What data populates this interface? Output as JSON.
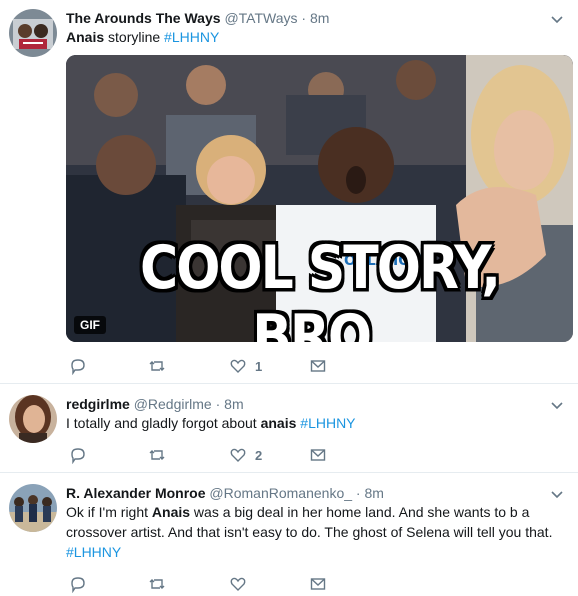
{
  "tweets": [
    {
      "name": "The Arounds The Ways",
      "handle": "@TATWays",
      "time": "8m",
      "text_bold": "Anais",
      "text_rest": " storyline ",
      "hashtag": "#LHHNY",
      "media": {
        "badge": "GIF",
        "caption": "COOL STORY, BRO.",
        "jersey_text": "OKLAHOMA C"
      },
      "actions": {
        "reply": "",
        "retweet": "",
        "like": "1",
        "dm": ""
      }
    },
    {
      "name": "redgirlme",
      "handle": "@Redgirlme",
      "time": "8m",
      "text_before": "I totally and gladly forgot about ",
      "text_bold": "anais",
      "hashtag": "#LHHNY",
      "actions": {
        "reply": "",
        "retweet": "",
        "like": "2",
        "dm": ""
      }
    },
    {
      "name": "R. Alexander Monroe",
      "handle": "@RomanRomanenko_",
      "time": "8m",
      "text_part1": "Ok if I'm right ",
      "text_bold": "Anais",
      "text_part2": " was a big deal in her home land. And she wants to b a crossover artist. And that isn't easy to do. The ghost of Selena will tell you that.",
      "hashtag": "#LHHNY",
      "actions": {
        "reply": "",
        "retweet": "",
        "like": "",
        "dm": ""
      }
    }
  ],
  "colors": {
    "accent": "#1b95e0",
    "muted": "#657786",
    "divider": "#e6ecf0"
  },
  "icons": [
    "chevron-down-icon",
    "reply-icon",
    "retweet-icon",
    "like-icon",
    "dm-icon"
  ]
}
